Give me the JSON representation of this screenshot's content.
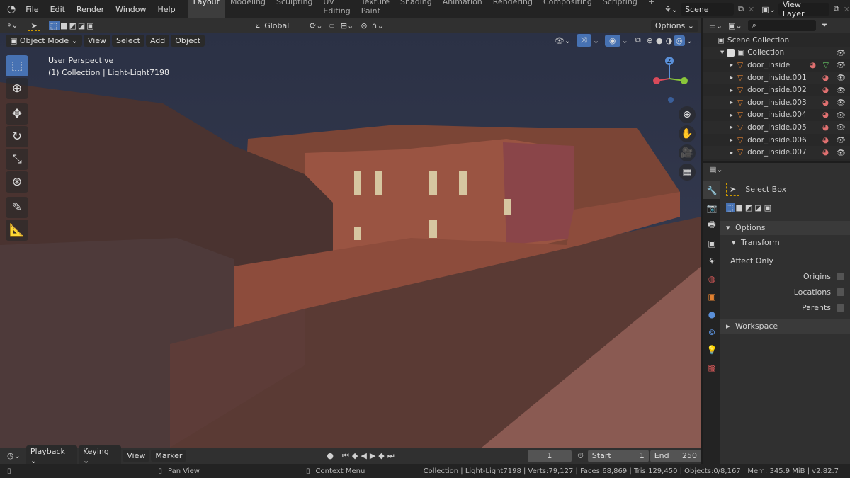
{
  "menu": [
    "File",
    "Edit",
    "Render",
    "Window",
    "Help"
  ],
  "workspaces": [
    "Layout",
    "Modeling",
    "Sculpting",
    "UV Editing",
    "Texture Paint",
    "Shading",
    "Animation",
    "Rendering",
    "Compositing",
    "Scripting"
  ],
  "scene": "Scene",
  "view_layer": "View Layer",
  "tool_header": {
    "orientation": "Global",
    "options": "Options"
  },
  "viewport": {
    "mode": "Object Mode",
    "menus": [
      "View",
      "Select",
      "Add",
      "Object"
    ],
    "perspective": "User Perspective",
    "active": "(1) Collection | Light-Light7198",
    "gizmo_axis": "Z"
  },
  "outliner": {
    "search_placeholder": "",
    "scene_collection": "Scene Collection",
    "collection": "Collection",
    "items": [
      "door_inside",
      "door_inside.001",
      "door_inside.002",
      "door_inside.003",
      "door_inside.004",
      "door_inside.005",
      "door_inside.006",
      "door_inside.007"
    ]
  },
  "properties": {
    "tool": "Select Box",
    "options": "Options",
    "transform": "Transform",
    "affect_only": "Affect Only",
    "origins": "Origins",
    "locations": "Locations",
    "parents": "Parents",
    "workspace": "Workspace"
  },
  "timeline": {
    "menus": [
      "Playback",
      "Keying",
      "View",
      "Marker"
    ],
    "current_frame": "1",
    "start_label": "Start",
    "start": "1",
    "end_label": "End",
    "end": "250"
  },
  "status": {
    "left": "Pan View",
    "middle": "Context Menu",
    "info": "Collection | Light-Light7198 | Verts:79,127 | Faces:68,869 | Tris:129,450 | Objects:0/8,167 | Mem: 345.9 MiB | v2.82.7"
  },
  "colors": {
    "accent": "#4772b3",
    "sky": "#2d3449",
    "ground": "#5a3a34"
  }
}
